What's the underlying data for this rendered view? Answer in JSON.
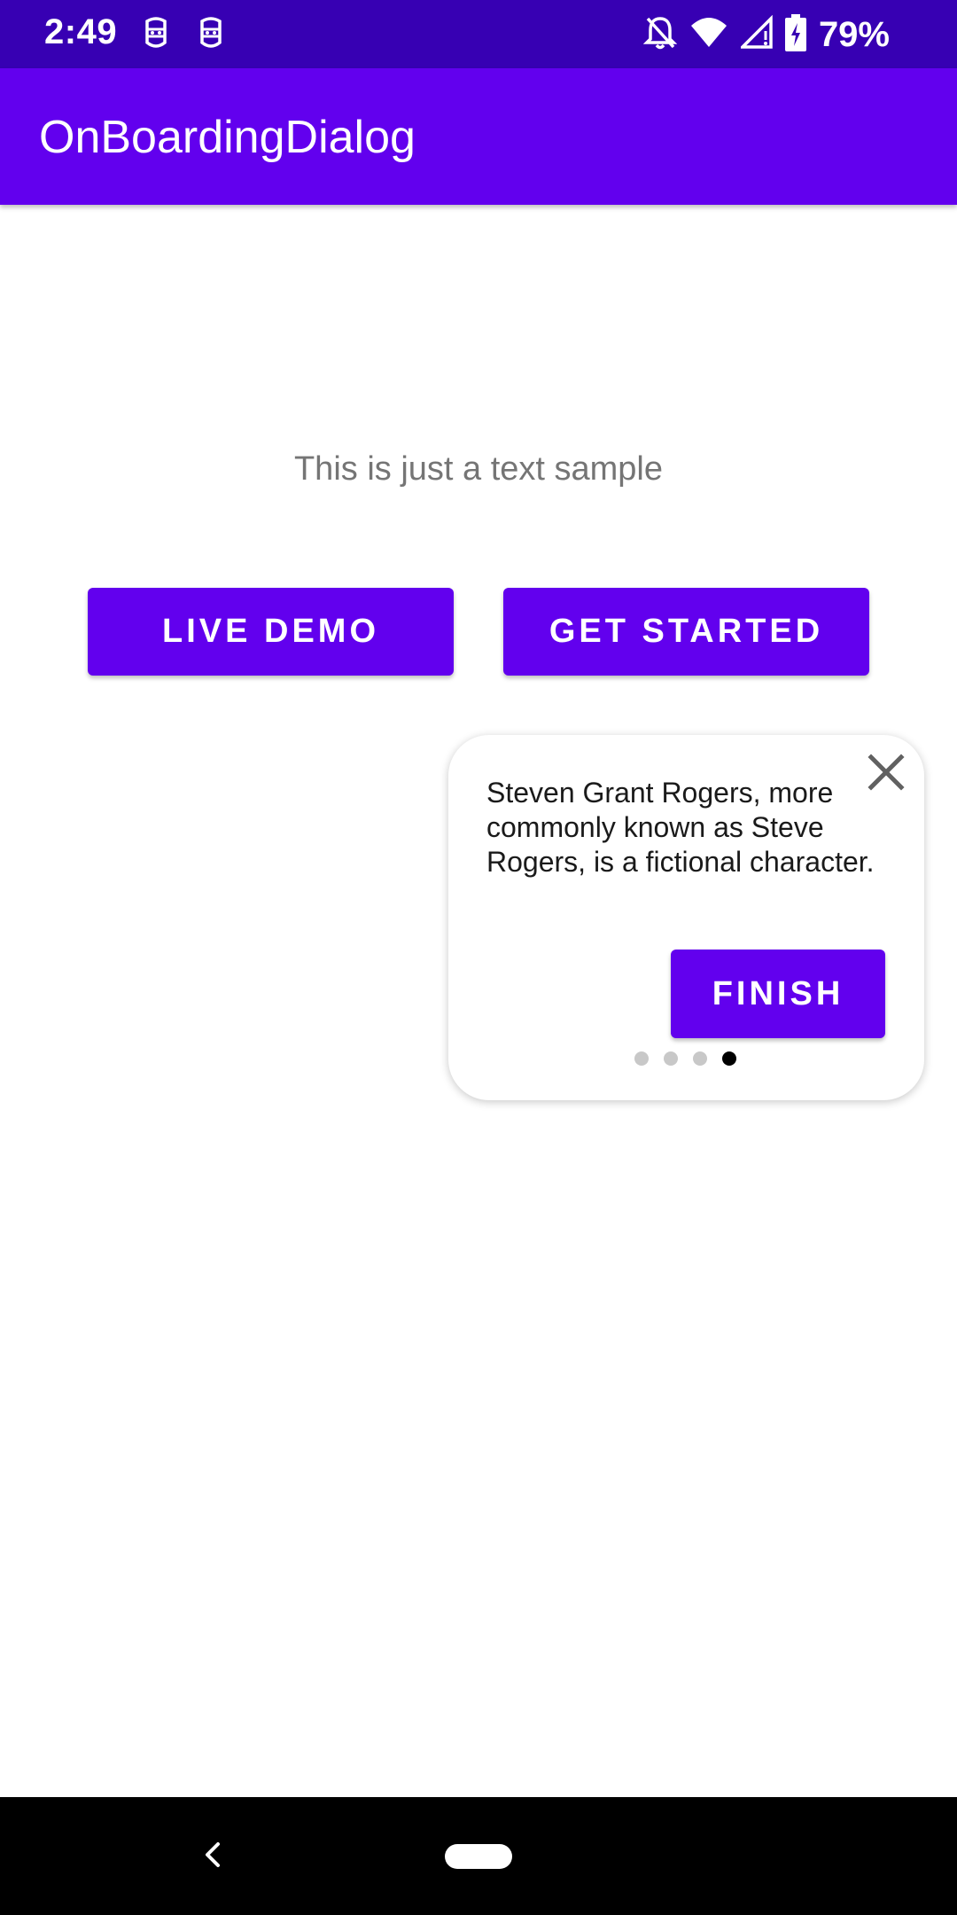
{
  "status_bar": {
    "time": "2:49",
    "battery_percent": "79%",
    "icons": [
      "notification-app-icon",
      "notification-app-icon",
      "bell-off-icon",
      "wifi-icon",
      "signal-icon",
      "battery-charging-icon"
    ]
  },
  "app_bar": {
    "title": "OnBoardingDialog"
  },
  "main": {
    "sample_text": "This is just a text sample",
    "live_demo_label": "LIVE DEMO",
    "get_started_label": "GET STARTED"
  },
  "onboarding_tooltip": {
    "body": "Steven Grant Rogers, more commonly known as Steve Rogers, is a fictional character.",
    "finish_label": "FINISH",
    "page_count": 4,
    "current_page": 4
  },
  "colors": {
    "status_bar": "#3700b3",
    "primary": "#6200ee",
    "sample_text": "#757575",
    "dot_inactive": "#c8c8c8",
    "dot_active": "#000000"
  }
}
